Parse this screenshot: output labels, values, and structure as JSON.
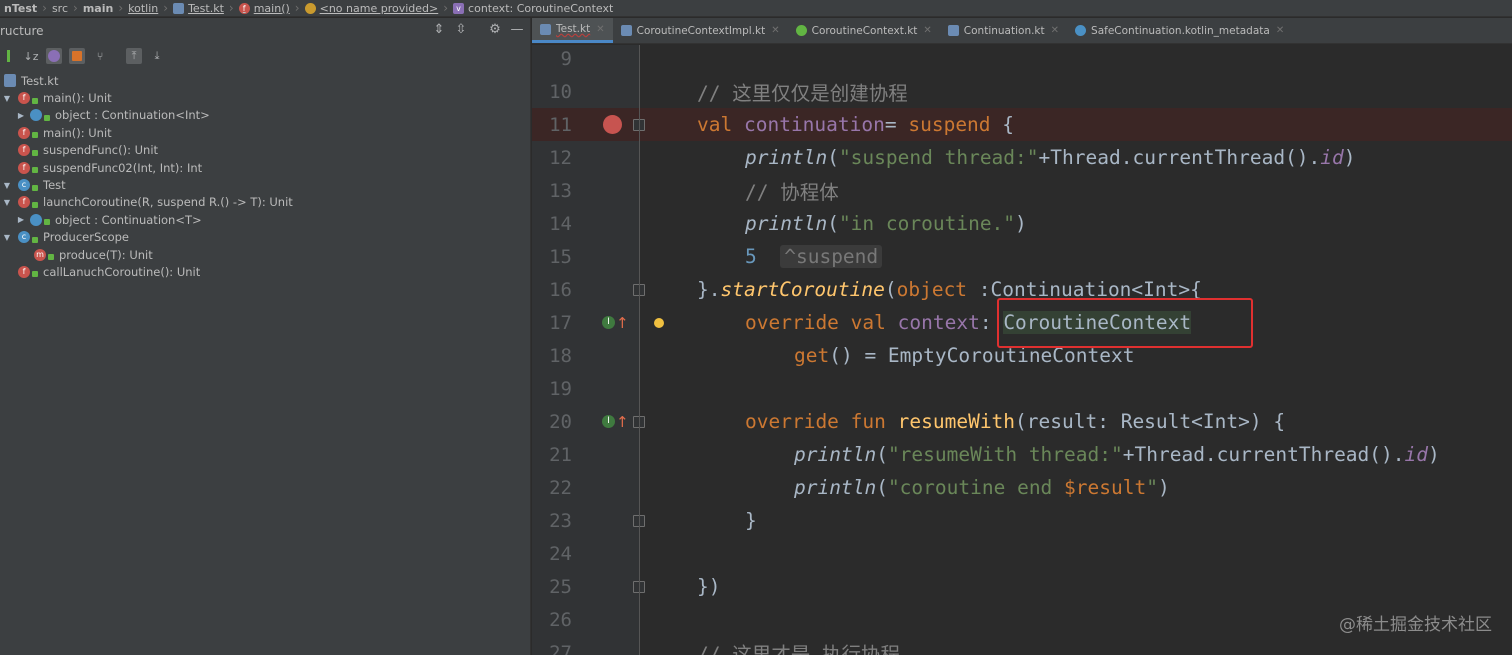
{
  "breadcrumb": [
    {
      "label": "nTest",
      "bold": true
    },
    {
      "label": "src"
    },
    {
      "label": "main",
      "bold": true
    },
    {
      "label": "kotlin",
      "underline": true
    },
    {
      "label": "Test.kt",
      "underline": true,
      "icon": "kotlin-file-icon"
    },
    {
      "label": "main()",
      "underline": true,
      "icon": "function-icon"
    },
    {
      "label": "<no name provided>",
      "underline": true,
      "icon": "object-icon"
    },
    {
      "label": "context: CoroutineContext",
      "icon": "property-icon"
    }
  ],
  "structure_panel": {
    "title": "ructure",
    "tree": [
      {
        "label": "Test.kt",
        "indent": 0,
        "icon": "file"
      },
      {
        "label": "main(): Unit",
        "indent": 0,
        "icon": "f",
        "arrow": "▼"
      },
      {
        "label": "object : Continuation<Int>",
        "indent": 1,
        "icon": "o",
        "arrow": "▶"
      },
      {
        "label": "main(): Unit",
        "indent": 0,
        "icon": "f"
      },
      {
        "label": "suspendFunc(): Unit",
        "indent": 0,
        "icon": "f"
      },
      {
        "label": "suspendFunc02(Int, Int): Int",
        "indent": 0,
        "icon": "f"
      },
      {
        "label": "Test",
        "indent": 0,
        "icon": "c",
        "arrow": "▼"
      },
      {
        "label": "launchCoroutine(R, suspend R.() -> T): Unit",
        "indent": 0,
        "icon": "f",
        "arrow": "▼"
      },
      {
        "label": "object : Continuation<T>",
        "indent": 1,
        "icon": "o",
        "arrow": "▶"
      },
      {
        "label": "ProducerScope",
        "indent": 0,
        "icon": "c",
        "arrow": "▼"
      },
      {
        "label": "produce(T): Unit",
        "indent": 1,
        "icon": "m"
      },
      {
        "label": "callLanuchCoroutine(): Unit",
        "indent": 0,
        "icon": "f"
      }
    ]
  },
  "tabs": [
    {
      "label": "Test.kt",
      "active": true,
      "color": "#6b8bb3"
    },
    {
      "label": "CoroutineContextImpl.kt",
      "color": "#6b8bb3"
    },
    {
      "label": "CoroutineContext.kt",
      "color": "#62b543"
    },
    {
      "label": "Continuation.kt",
      "color": "#6b8bb3"
    },
    {
      "label": "SafeContinuation.kotlin_metadata",
      "color": "#4a90c4"
    }
  ],
  "editor": {
    "line_numbers": [
      "9",
      "10",
      "11",
      "12",
      "13",
      "14",
      "15",
      "16",
      "17",
      "18",
      "19",
      "20",
      "21",
      "22",
      "23",
      "24",
      "25",
      "26",
      "27"
    ],
    "comment_create": "// 这里仅仅是创建协程",
    "comment_body": "// 协程体",
    "comment_exec": "// 这里才是 执行协程",
    "hint_suspend": "^suspend",
    "string_suspend_thread": "\"suspend thread:\"",
    "string_in_coroutine": "\"in coroutine.\"",
    "string_resume_thread": "\"resumeWith thread:\"",
    "string_coroutine_end_prefix": "\"coroutine end ",
    "string_coroutine_end_var": "$result",
    "string_coroutine_end_suffix": "\"",
    "highlighted_type": "CoroutineContext"
  },
  "watermark": "@稀土掘金技术社区",
  "colors": {
    "editor_bg": "#2b2b2b",
    "keyword": "#cc7832",
    "string": "#6a8759",
    "comment": "#808080",
    "function": "#ffc66d",
    "property": "#9876aa",
    "number": "#6897bb",
    "annotation_box": "#e03030"
  }
}
